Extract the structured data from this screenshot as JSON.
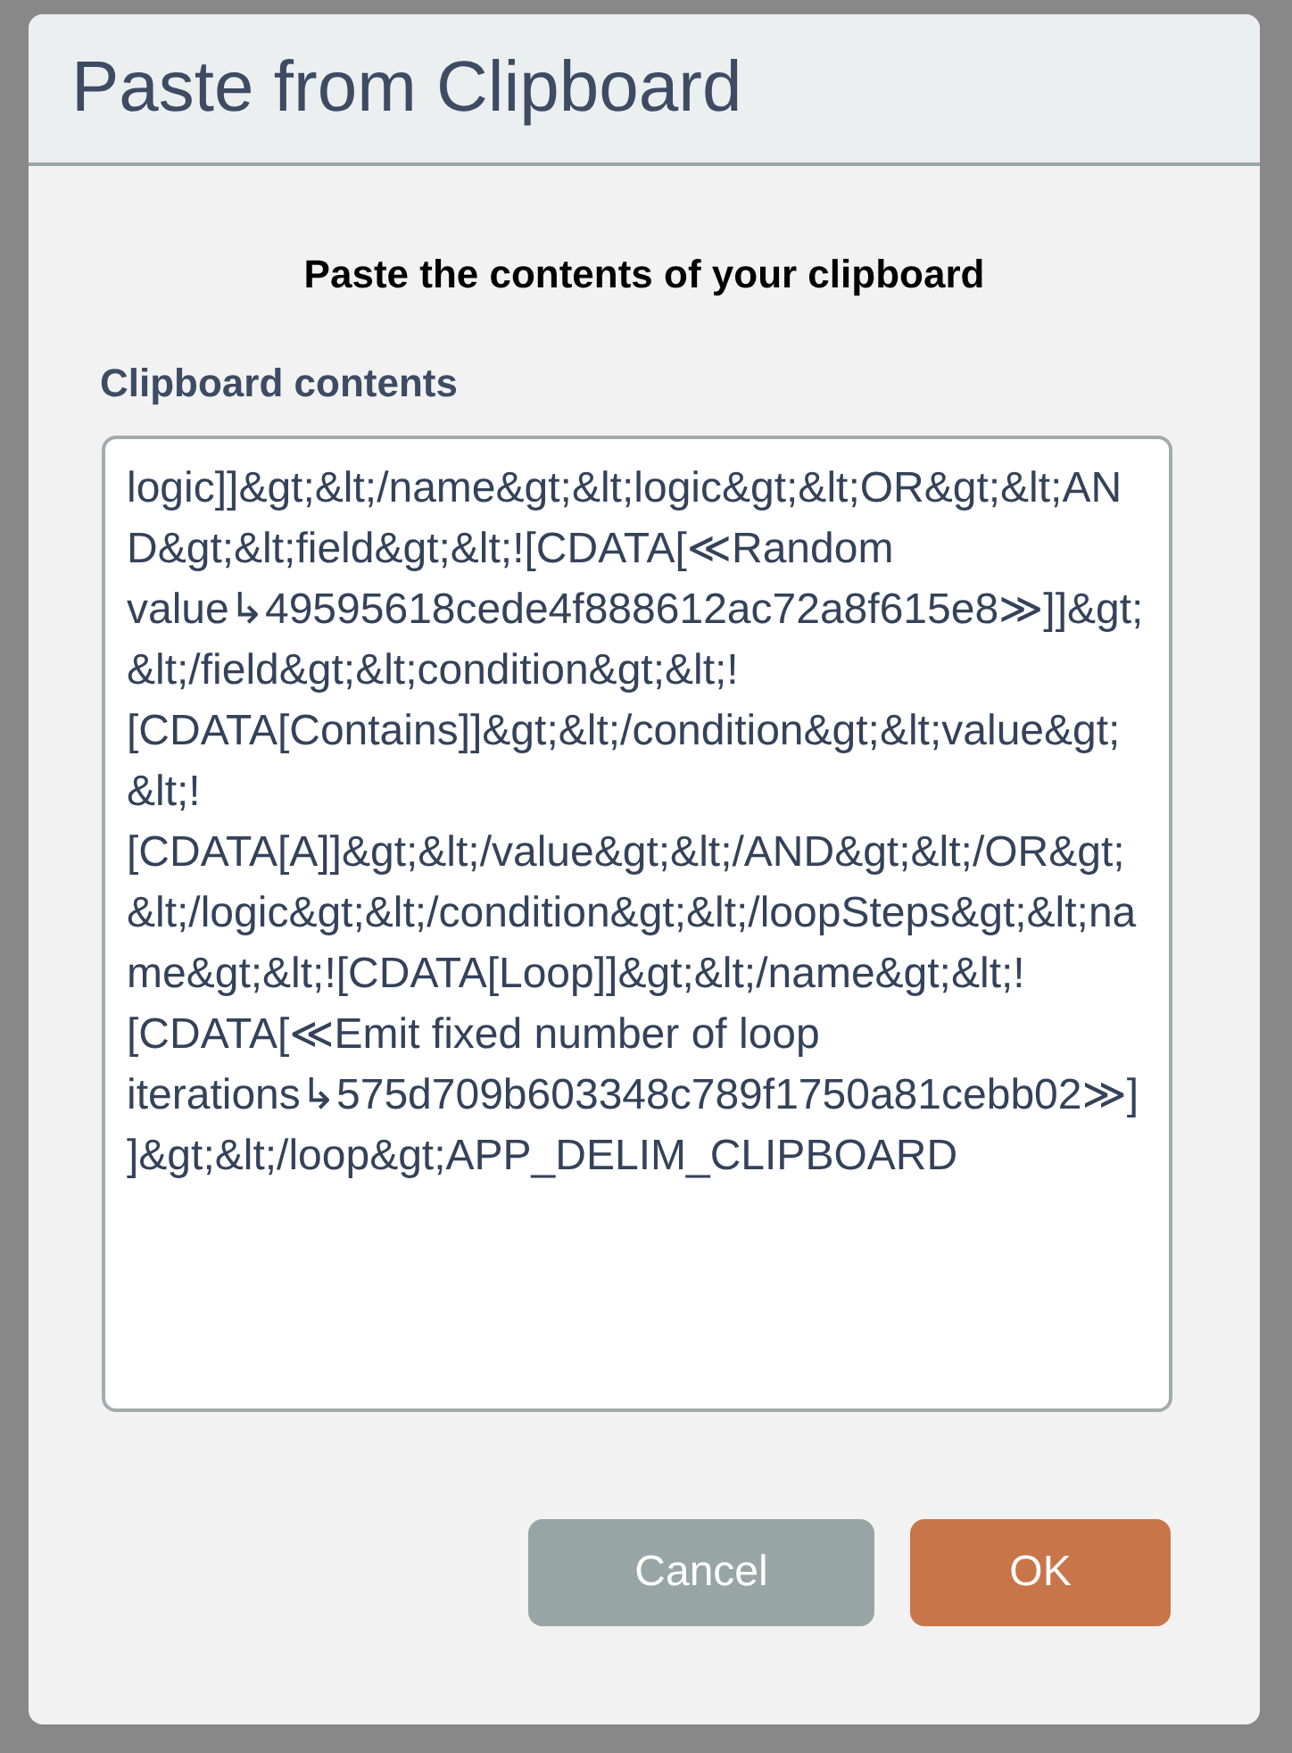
{
  "dialog": {
    "title": "Paste from Clipboard",
    "heading": "Paste the contents of your clipboard",
    "field": {
      "label": "Clipboard contents",
      "value": "logic]]&gt;&lt;/name&gt;&lt;logic&gt;&lt;OR&gt;&lt;AND&gt;&lt;field&gt;&lt;![CDATA[≪Random value↳49595618cede4f888612ac72a8f615e8≫]]&gt;&lt;/field&gt;&lt;condition&gt;&lt;![CDATA[Contains]]&gt;&lt;/condition&gt;&lt;value&gt;&lt;![CDATA[A]]&gt;&lt;/value&gt;&lt;/AND&gt;&lt;/OR&gt;&lt;/logic&gt;&lt;/condition&gt;&lt;/loopSteps&gt;&lt;name&gt;&lt;![CDATA[Loop]]&gt;&lt;/name&gt;&lt;![CDATA[≪Emit fixed number of loop iterations↳575d709b603348c789f1750a81cebb02≫]]&gt;&lt;/loop&gt;APP_DELIM_CLIPBOARD"
    },
    "buttons": [
      {
        "label": "Cancel",
        "kind": "secondary"
      },
      {
        "label": "OK",
        "kind": "primary"
      }
    ]
  }
}
